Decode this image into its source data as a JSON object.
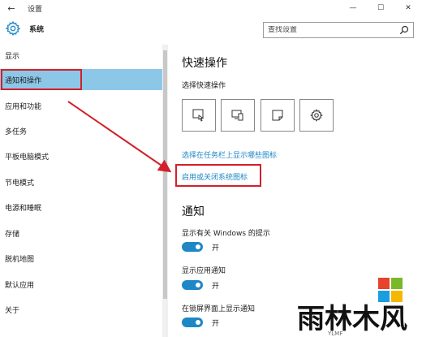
{
  "window": {
    "title": "设置",
    "back_glyph": "←",
    "minimize_glyph": "—",
    "maximize_glyph": "☐",
    "close_glyph": "✕"
  },
  "header": {
    "title": "系统",
    "search_placeholder": "查找设置"
  },
  "sidebar": {
    "items": [
      {
        "label": "显示"
      },
      {
        "label": "通知和操作",
        "active": true
      },
      {
        "label": "应用和功能"
      },
      {
        "label": "多任务"
      },
      {
        "label": "平板电脑模式"
      },
      {
        "label": "节电模式"
      },
      {
        "label": "电源和睡眠"
      },
      {
        "label": "存储"
      },
      {
        "label": "脱机地图"
      },
      {
        "label": "默认应用"
      },
      {
        "label": "关于"
      }
    ]
  },
  "main": {
    "quick_actions": {
      "title": "快速操作",
      "subtitle": "选择快速操作",
      "tiles": [
        {
          "icon": "tablet-mode-icon"
        },
        {
          "icon": "connect-icon"
        },
        {
          "icon": "note-icon"
        },
        {
          "icon": "settings-icon"
        }
      ],
      "link_taskbar_icons": "选择在任务栏上显示哪些图标",
      "link_system_icons": "启用或关闭系统图标"
    },
    "notifications": {
      "title": "通知",
      "options": [
        {
          "label": "显示有关 Windows 的提示",
          "state": "开"
        },
        {
          "label": "显示应用通知",
          "state": "开"
        },
        {
          "label": "在锁屏界面上显示通知",
          "state": "开"
        }
      ]
    }
  },
  "annotations": {
    "color": "#d2202a"
  },
  "watermark": {
    "text": "雨林木风",
    "subtext": "YLMF"
  },
  "colors": {
    "accent": "#1e87c6",
    "active_nav": "#8dc7e8"
  }
}
